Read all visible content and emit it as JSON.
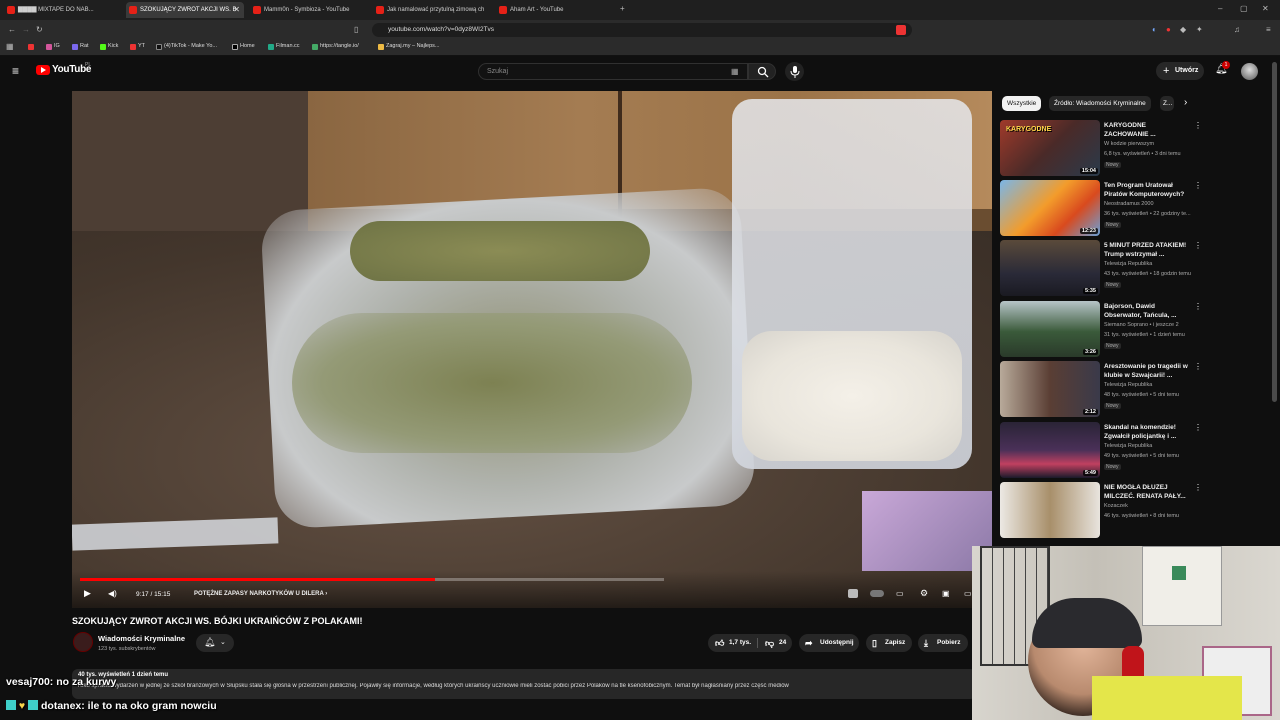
{
  "browser": {
    "tabs": [
      {
        "label": "▇▇▇▇ MIXTAPE DO NAB..."
      },
      {
        "label": "SZOKUJĄCY ZWROT AKCJI WS. B"
      },
      {
        "label": "Mamm0n - Symbioza - YouTube"
      },
      {
        "label": "Jak namalować przytulną zimową ch"
      },
      {
        "label": "Aham Art - YouTube"
      }
    ],
    "url": "youtube.com/watch?v=0dyz8WI2Tvs",
    "bookmarks": [
      "IG",
      "Rat",
      "Kick",
      "YT",
      "(4)TikTok - Make Yo...",
      "Home",
      "Filman.cc",
      "https://tangle.io/",
      "Zagraj.my – Najleps..."
    ]
  },
  "youtube": {
    "logo": "YouTube",
    "logo_region": "PL",
    "search_placeholder": "Szukaj",
    "create_label": "Utwórz",
    "notif_count": "1"
  },
  "player": {
    "time": "9:17 / 15:15",
    "chapter": "POTĘŻNE ZAPASY NARKOTYKÓW U DILERA",
    "progress": 0.608
  },
  "video": {
    "title": "SZOKUJĄCY ZWROT AKCJI WS. BÓJKI UKRAIŃCÓW Z POLAKAMI!",
    "channel": "Wiadomości Kryminalne",
    "subscribers": "123 tys. subskrybentów",
    "likes": "1,7 tys.",
    "dislikes": "24",
    "share": "Udostępnij",
    "save": "Zapisz",
    "download": "Pobierz",
    "views_date": "40 tys. wyświetleń  1 dzień temu",
    "description": "roku sprawa wydarzeń w jednej ze szkół branżowych w Słupsku stała się głośna w przestrzeni publicznej. Pojawiły się informacje, według których ukraińscy uczniowie mieli zostać pobici przez Polaków na tle ksenofobicznym. Temat był nagłaśniany przez część mediów"
  },
  "sidebar": {
    "chips": [
      "Wszystkie",
      "Źródło: Wiadomości Kryminalne",
      "Z..."
    ],
    "items": [
      {
        "title": "KARYGODNE ZACHOWANIE ...",
        "channel": "W kodzie pierwszym",
        "views": "6,8 tys. wyświetleń • 3 dni temu",
        "badge": "Nowy",
        "duration": "15:04"
      },
      {
        "title": "Ten Program Uratował Piratów Komputerowych?",
        "channel": "Neostradamus 2000",
        "views": "36 tys. wyświetleń • 22 godziny te...",
        "badge": "Nowy",
        "duration": "12:23"
      },
      {
        "title": "5 MINUT PRZED ATAKIEM! Trump wstrzymał ...",
        "channel": "Telewizja Republika",
        "views": "43 tys. wyświetleń • 18 godzin temu",
        "badge": "Nowy",
        "duration": "5:35"
      },
      {
        "title": "Bajorson, Dawid Obserwator, Tańcula, ...",
        "channel": "Siemano Soprano • i jeszcze 2",
        "views": "31 tys. wyświetleń • 1 dzień temu",
        "badge": "Nowy",
        "duration": "3:26"
      },
      {
        "title": "Aresztowanie po tragedii w klubie w Szwajcarii! ...",
        "channel": "Telewizja Republika",
        "views": "48 tys. wyświetleń • 5 dni temu",
        "badge": "Nowy",
        "duration": "2:12"
      },
      {
        "title": "Skandal na komendzie! Zgwałcił policjantkę i ...",
        "channel": "Telewizja Republika",
        "views": "49 tys. wyświetleń • 5 dni temu",
        "badge": "Nowy",
        "duration": "5:49"
      },
      {
        "title": "NIE MOGŁA DŁUŻEJ MILCZEĆ. RENATA PAŁY...",
        "channel": "Kozaczek",
        "views": "46 tys. wyświetleń • 8 dni temu",
        "badge": "",
        "duration": ""
      }
    ]
  },
  "chat": [
    {
      "user": "vesaj700",
      "text": ": no za kurwy"
    },
    {
      "user": "dotanex",
      "text": ": ile to na oko gram nowciu"
    }
  ],
  "colors": {
    "accent": "#ff0000",
    "bg": "#0f0f0f",
    "chip": "#272727"
  }
}
